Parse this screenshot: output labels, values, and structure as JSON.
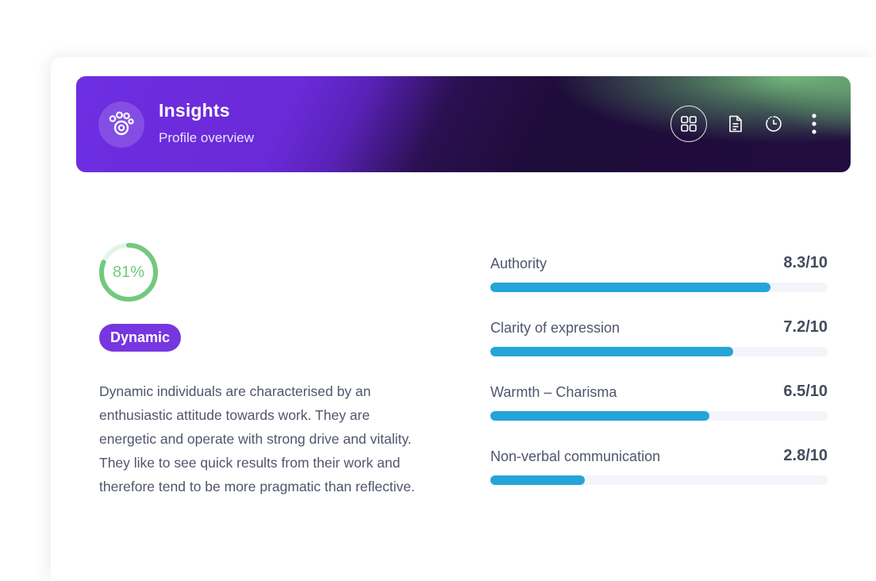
{
  "header": {
    "title": "Insights",
    "subtitle": "Profile overview",
    "logo_icon": "paw-icon",
    "actions": [
      {
        "name": "grid-view",
        "icon": "grid-icon"
      },
      {
        "name": "document",
        "icon": "document-icon"
      },
      {
        "name": "history",
        "icon": "clock-icon"
      },
      {
        "name": "more",
        "icon": "more-vertical-icon"
      }
    ]
  },
  "profile": {
    "score_label": "81%",
    "score": 0.81,
    "type": "Dynamic",
    "description": "Dynamic individuals are characterised by an enthusiastic attitude towards work. They are energetic and operate with strong drive and vitality. They like to see quick results from their work and therefore tend to be more pragmatic than reflective."
  },
  "metrics": [
    {
      "label": "Authority",
      "score": "8.3/10",
      "value": 8.3
    },
    {
      "label": "Clarity of expression",
      "score": "7.2/10",
      "value": 7.2
    },
    {
      "label": "Warmth – Charisma",
      "score": "6.5/10",
      "value": 6.5
    },
    {
      "label": "Non-verbal communication",
      "score": "2.8/10",
      "value": 2.8
    }
  ],
  "colors": {
    "accent_purple": "#7636e0",
    "ring_green": "#72c97e",
    "bar_blue": "#25a4d9"
  }
}
